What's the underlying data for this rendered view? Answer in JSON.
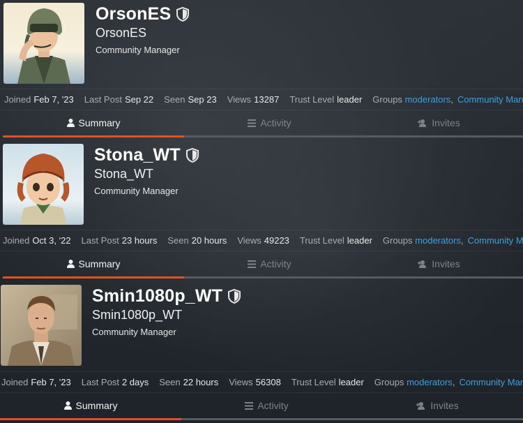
{
  "profiles": [
    {
      "username": "OrsonES",
      "full_name": "OrsonES",
      "title": "Community Manager",
      "avatar_icon": "pilot-helmet-avatar",
      "stats": {
        "joined_label": "Joined",
        "joined": "Feb 7, '23",
        "last_post_label": "Last Post",
        "last_post": "Sep 22",
        "seen_label": "Seen",
        "seen": "Sep 23",
        "views_label": "Views",
        "views": "13287",
        "trust_label": "Trust Level",
        "trust": "leader",
        "groups_label": "Groups",
        "group1": "moderators",
        "group2": "Community Manager ..."
      }
    },
    {
      "username": "Stona_WT",
      "full_name": "Stona_WT",
      "title": "Community Manager",
      "avatar_icon": "aviator-cap-avatar",
      "stats": {
        "joined_label": "Joined",
        "joined": "Oct 3, '22",
        "last_post_label": "Last Post",
        "last_post": "23 hours",
        "seen_label": "Seen",
        "seen": "20 hours",
        "views_label": "Views",
        "views": "49223",
        "trust_label": "Trust Level",
        "trust": "leader",
        "groups_label": "Groups",
        "group1": "moderators",
        "group2": "Community Manager ..."
      }
    },
    {
      "username": "Smin1080p_WT",
      "full_name": "Smin1080p_WT",
      "title": "Community Manager",
      "avatar_icon": "officer-portrait-avatar",
      "stats": {
        "joined_label": "Joined",
        "joined": "Feb 7, '23",
        "last_post_label": "Last Post",
        "last_post": "2 days",
        "seen_label": "Seen",
        "seen": "22 hours",
        "views_label": "Views",
        "views": "56308",
        "trust_label": "Trust Level",
        "trust": "leader",
        "groups_label": "Groups",
        "group1": "moderators",
        "group2": "Community Manager ..."
      }
    }
  ],
  "tabs": {
    "summary": "Summary",
    "activity": "Activity",
    "invites": "Invites"
  },
  "colors": {
    "accent": "#e0531f",
    "link": "#3ba0e0",
    "background": "#20252b"
  },
  "icons": {
    "moderator": "shield-icon",
    "summary": "user-icon",
    "activity": "stream-icon",
    "invites": "user-plus-icon"
  }
}
